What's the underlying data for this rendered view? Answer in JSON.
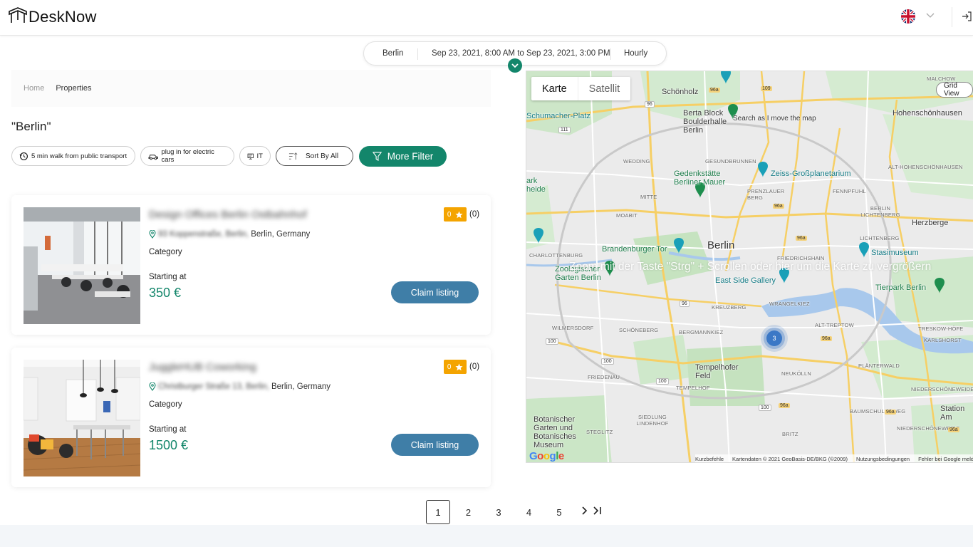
{
  "header": {
    "logo_text": "DeskNow",
    "language_flag": "uk-flag-icon",
    "logout_icon": "logout-icon"
  },
  "search": {
    "city": "Berlin",
    "date_range": "Sep 23, 2021, 8:00 AM to Sep 23, 2021, 3:00 PM",
    "booking_mode": "Hourly"
  },
  "breadcrumb": {
    "home": "Home",
    "current": "Properties"
  },
  "query_title": "\"Berlin\"",
  "filters": [
    {
      "label": "5 min walk from public transport",
      "icon": "clock-icon"
    },
    {
      "label": "plug in for electric cars",
      "icon": "car-icon"
    },
    {
      "label": "IT",
      "icon": "monitor-icon"
    },
    {
      "label": "Sort By All",
      "icon": "sort-icon"
    }
  ],
  "more_filter_label": "More Filter",
  "listings": [
    {
      "title": "Design Offices Berlin Ostbahnhof",
      "address_blurred": "93 Koppenstraße, Berlin,",
      "address_visible": "Berlin, Germany",
      "category": "Category",
      "starting_at": "Starting at",
      "price": "350 €",
      "rating_value": "0",
      "rating_count": "(0)",
      "claim_label": "Claim listing"
    },
    {
      "title": "JuggleHUB Coworking",
      "address_blurred": "Christburger Straße 13, Berlin,",
      "address_visible": "Berlin, Germany",
      "category": "Category",
      "starting_at": "Starting at",
      "price": "1500 €",
      "rating_value": "0",
      "rating_count": "(0)",
      "claim_label": "Claim listing"
    }
  ],
  "map": {
    "tabs": [
      "Karte",
      "Satellit"
    ],
    "active_tab": "Karte",
    "grid_view_label": "Grid View",
    "move_map_label": "Search as I move the map",
    "hint": "Zoom mit der Taste \"Strg\" + Scrollen oder hier um die Karte zu vergrößern",
    "cluster_count": "3",
    "google": "Google",
    "footer": [
      "Kurzbefehle",
      "Kartendaten © 2021 GeoBasis-DE/BKG (©2009)",
      "Nutzungsbedingungen",
      "Fehler bei Google melden"
    ],
    "labels": {
      "schoenholz": "Schönholz",
      "berta_block": "Berta Block Boulderhalle Berlin",
      "hohenschoenhausen": "Hohenschönhausen",
      "schumacher_platz": "Schumacher-Platz",
      "zeiss": "Zeiss-Großplanetarium",
      "gedenkstaette": "Gedenkstätte Berliner Mauer",
      "brandenburger_tor": "Brandenburger Tor",
      "berlin": "Berlin",
      "stasimuseum": "Stasimuseum",
      "herzberge": "Herzberge",
      "zoologischer_garten": "Zoologischer Garten Berlin",
      "east_side_gallery": "East Side Gallery",
      "tierpark": "Tierpark Berlin",
      "tempelhofer_feld": "Tempelhofer Feld",
      "botanischer_garten": "Botanischer Garten und Botanisches Museum",
      "station_am": "Station Am",
      "mark_heide": "ark heide",
      "malchow": "MALCHOW",
      "wedding": "WEDDING",
      "gesundbrunnen": "GESUNDBRUNNEN",
      "mitte": "MITTE",
      "moabit": "MOABIT",
      "prenzlauer_berg": "PRENZLAUER BERG",
      "fennpfuhl": "FENNPFUHL",
      "alt_hohenschoenhausen": "ALT-HOHENSCHÖNHAUSEN",
      "berlin_lichtenberg": "BERLIN LICHTENBERG",
      "lichtenberg": "LICHTENBERG",
      "friedrichshain": "FRIEDRICHSHAIN",
      "charlottenburg": "CHARLOTTENBURG",
      "kreuzberg": "KREUZBERG",
      "wrangelkiez": "WRANGELKIEZ",
      "alt_treptow": "ALT-TREPTOW",
      "wilmersdorf": "WILMERSDORF",
      "schoeneberg": "SCHÖNEBERG",
      "bergmannkiez": "BERGMANNKIEZ",
      "treskow": "TRESKOW-HÖFE",
      "karlshorst": "KARLSHORST",
      "friedenau": "FRIEDENAU",
      "tempelhof": "TEMPELHOF",
      "neukoelln": "NEUKÖLLN",
      "plaenterwald": "PLÄNTERWALD",
      "niederschoeneweide": "NIEDERSCHÖNEWEIDE",
      "siedlung_lindenhof": "SIEDLUNG LINDENHOF",
      "steglitz": "STEGLITZ",
      "baumschulenweg": "BAUMSCHULENWEG",
      "britz": "BRITZ",
      "niedersch": "NIEDERSCHÖNEWEIDE"
    },
    "road_numbers": [
      "96a",
      "109",
      "96",
      "111",
      "96a",
      "96a",
      "100",
      "96",
      "96a",
      "100",
      "96a",
      "100",
      "96a",
      "100",
      "96a"
    ]
  },
  "pagination": {
    "pages": [
      "1",
      "2",
      "3",
      "4",
      "5"
    ],
    "current": "1"
  },
  "colors": {
    "brand_green": "#13866b",
    "claim_blue": "#3f7ea7",
    "rating_orange": "#f4a400"
  }
}
